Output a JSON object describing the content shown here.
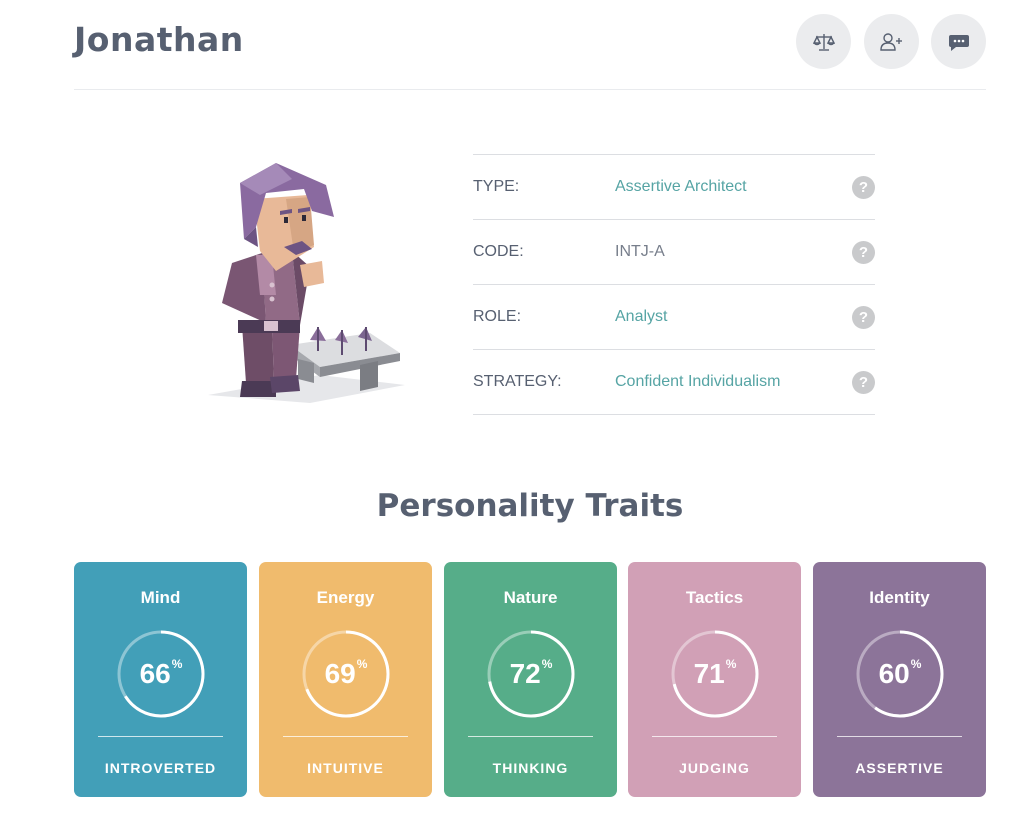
{
  "profile": {
    "name": "Jonathan"
  },
  "actions": [
    {
      "name": "compare-button",
      "icon": "scale-icon"
    },
    {
      "name": "add-friend-button",
      "icon": "add-user-icon"
    },
    {
      "name": "message-button",
      "icon": "chat-icon"
    }
  ],
  "info": {
    "type": {
      "label": "TYPE:",
      "value": "Assertive Architect"
    },
    "code": {
      "label": "CODE:",
      "value": "INTJ-A"
    },
    "role": {
      "label": "ROLE:",
      "value": "Analyst"
    },
    "strategy": {
      "label": "STRATEGY:",
      "value": "Confident Individualism"
    },
    "help_glyph": "?"
  },
  "traits_section": {
    "title": "Personality Traits"
  },
  "traits": [
    {
      "name": "Mind",
      "percent": 66,
      "side": "INTROVERTED",
      "color": "#429fb8"
    },
    {
      "name": "Energy",
      "percent": 69,
      "side": "INTUITIVE",
      "color": "#f0bb6d"
    },
    {
      "name": "Nature",
      "percent": 72,
      "side": "THINKING",
      "color": "#56ad89"
    },
    {
      "name": "Tactics",
      "percent": 71,
      "side": "JUDGING",
      "color": "#d1a0b6"
    },
    {
      "name": "Identity",
      "percent": 60,
      "side": "ASSERTIVE",
      "color": "#8c7499"
    }
  ],
  "percent_sign": "%",
  "colors": {
    "accent": "#56a4a4",
    "text": "#576071",
    "help": "#c9cacc"
  }
}
